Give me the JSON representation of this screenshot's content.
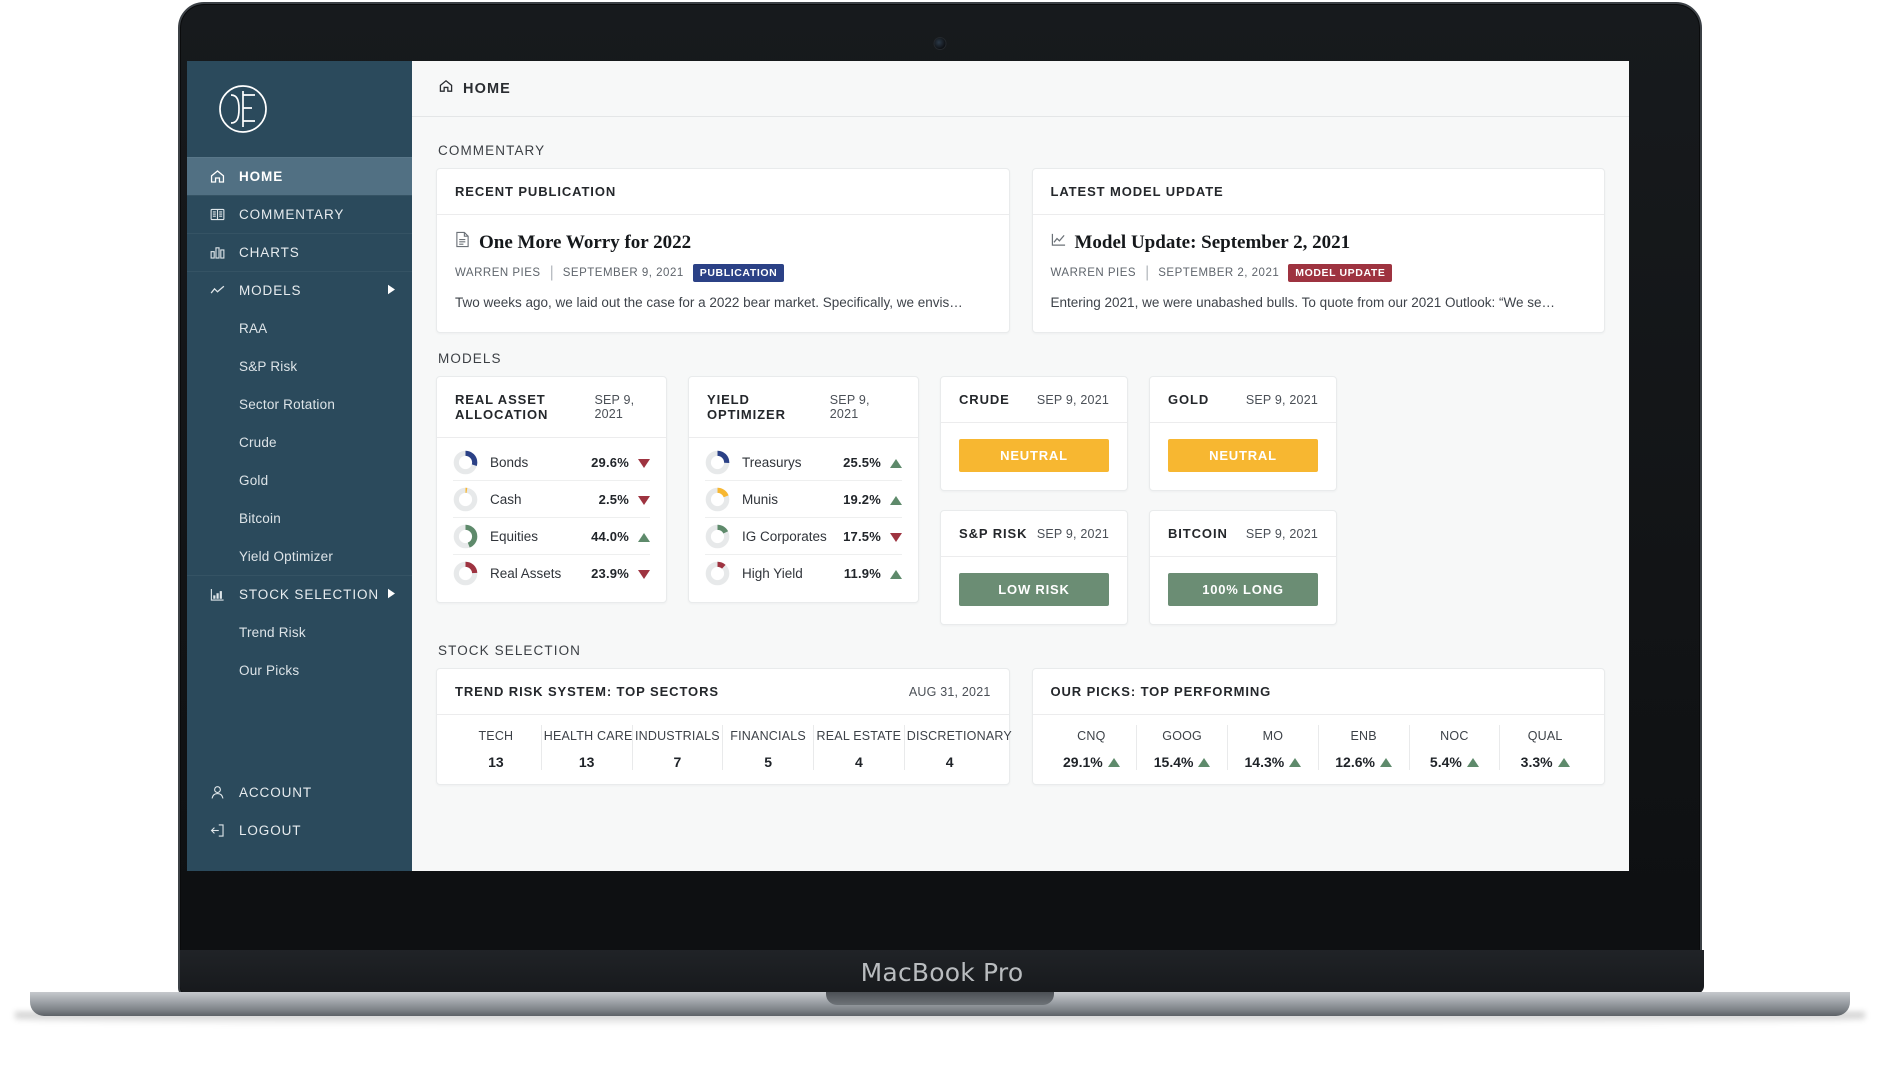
{
  "device": {
    "label": "MacBook Pro"
  },
  "brand": {
    "logo_alt": "AF monogram logo"
  },
  "sidebar": {
    "items": [
      {
        "label": "HOME",
        "icon": "home-icon",
        "active": true
      },
      {
        "label": "COMMENTARY",
        "icon": "book-icon",
        "active": false
      },
      {
        "label": "CHARTS",
        "icon": "bar-chart-icon",
        "active": false
      },
      {
        "label": "MODELS",
        "icon": "line-chart-icon",
        "active": false,
        "expandable": true
      }
    ],
    "models_sub": [
      "RAA",
      "S&P Risk",
      "Sector Rotation",
      "Crude",
      "Gold",
      "Bitcoin",
      "Yield Optimizer"
    ],
    "stock_selection": {
      "label": "STOCK SELECTION",
      "icon": "chart-bars-icon",
      "expandable": true
    },
    "stock_sub": [
      "Trend Risk",
      "Our Picks"
    ],
    "bottom": [
      {
        "label": "ACCOUNT",
        "icon": "user-icon"
      },
      {
        "label": "LOGOUT",
        "icon": "logout-icon"
      }
    ]
  },
  "topbar": {
    "title": "HOME",
    "icon": "home-icon"
  },
  "sections": {
    "commentary": "COMMENTARY",
    "models": "MODELS",
    "stock_selection": "STOCK SELECTION"
  },
  "commentary": {
    "cards": [
      {
        "header": "RECENT PUBLICATION",
        "icon": "document-icon",
        "title": "One More Worry for 2022",
        "author": "WARREN PIES",
        "separator": "|",
        "date": "SEPTEMBER 9, 2021",
        "tag": "PUBLICATION",
        "tag_color": "#2b4186",
        "excerpt": "Two weeks ago, we laid out the case for a 2022 bear market. Specifically, we envis…"
      },
      {
        "header": "LATEST MODEL UPDATE",
        "icon": "line-chart-icon",
        "title": "Model Update: September 2, 2021",
        "author": "WARREN PIES",
        "separator": "|",
        "date": "SEPTEMBER 2, 2021",
        "tag": "MODEL UPDATE",
        "tag_color": "#9e3340",
        "excerpt": "Entering 2021, we were unabashed bulls. To quote from our 2021 Outlook: “We se…"
      }
    ]
  },
  "models": {
    "allocation_cards": [
      {
        "title": "REAL ASSET ALLOCATION",
        "date": "SEP 9, 2021",
        "rows": [
          {
            "name": "Bonds",
            "value": "29.6%",
            "pct": 29.6,
            "color": "#2b4186",
            "direction": "down"
          },
          {
            "name": "Cash",
            "value": "2.5%",
            "pct": 2.5,
            "color": "#f7b731",
            "direction": "down"
          },
          {
            "name": "Equities",
            "value": "44.0%",
            "pct": 44.0,
            "color": "#5e8a6b",
            "direction": "up"
          },
          {
            "name": "Real Assets",
            "value": "23.9%",
            "pct": 23.9,
            "color": "#9e3340",
            "direction": "down"
          }
        ]
      },
      {
        "title": "YIELD OPTIMIZER",
        "date": "SEP 9, 2021",
        "rows": [
          {
            "name": "Treasurys",
            "value": "25.5%",
            "pct": 25.5,
            "color": "#2b4186",
            "direction": "up"
          },
          {
            "name": "Munis",
            "value": "19.2%",
            "pct": 19.2,
            "color": "#f7b731",
            "direction": "up"
          },
          {
            "name": "IG Corporates",
            "value": "17.5%",
            "pct": 17.5,
            "color": "#5e8a6b",
            "direction": "down"
          },
          {
            "name": "High Yield",
            "value": "11.9%",
            "pct": 11.9,
            "color": "#9e3340",
            "direction": "up"
          }
        ]
      }
    ],
    "status_cards": [
      {
        "title": "CRUDE",
        "date": "SEP 9, 2021",
        "status": "NEUTRAL",
        "status_color": "#f7b731"
      },
      {
        "title": "S&P RISK",
        "date": "SEP 9, 2021",
        "status": "LOW RISK",
        "status_color": "#6b8d74"
      },
      {
        "title": "GOLD",
        "date": "SEP 9, 2021",
        "status": "NEUTRAL",
        "status_color": "#f7b731"
      },
      {
        "title": "BITCOIN",
        "date": "SEP 9, 2021",
        "status": "100% LONG",
        "status_color": "#6b8d74"
      }
    ]
  },
  "stock_selection": {
    "trend_risk": {
      "title": "TREND RISK SYSTEM: TOP SECTORS",
      "date": "AUG 31, 2021",
      "columns": [
        "TECH",
        "HEALTH CARE",
        "INDUSTRIALS",
        "FINANCIALS",
        "REAL ESTATE",
        "DISCRETIONARY"
      ],
      "values": [
        "13",
        "13",
        "7",
        "5",
        "4",
        "4"
      ]
    },
    "our_picks": {
      "title": "OUR PICKS: TOP PERFORMING",
      "date": "",
      "columns": [
        "CNQ",
        "GOOG",
        "MO",
        "ENB",
        "NOC",
        "QUAL"
      ],
      "values": [
        "29.1%",
        "15.4%",
        "14.3%",
        "12.6%",
        "5.4%",
        "3.3%"
      ],
      "directions": [
        "up",
        "up",
        "up",
        "up",
        "up",
        "up"
      ]
    }
  },
  "chart_data": {
    "type": "pie",
    "title": "Real Asset Allocation & Yield Optimizer donut gauges",
    "charts": [
      {
        "name": "REAL ASSET ALLOCATION",
        "categories": [
          "Bonds",
          "Cash",
          "Equities",
          "Real Assets"
        ],
        "values": [
          29.6,
          2.5,
          44.0,
          23.9
        ],
        "colors": [
          "#2b4186",
          "#f7b731",
          "#5e8a6b",
          "#9e3340"
        ],
        "unit": "%"
      },
      {
        "name": "YIELD OPTIMIZER",
        "categories": [
          "Treasurys",
          "Munis",
          "IG Corporates",
          "High Yield"
        ],
        "values": [
          25.5,
          19.2,
          17.5,
          11.9
        ],
        "colors": [
          "#2b4186",
          "#f7b731",
          "#5e8a6b",
          "#9e3340"
        ],
        "unit": "%"
      },
      {
        "name": "TREND RISK SYSTEM: TOP SECTORS",
        "type": "bar",
        "categories": [
          "TECH",
          "HEALTH CARE",
          "INDUSTRIALS",
          "FINANCIALS",
          "REAL ESTATE",
          "DISCRETIONARY"
        ],
        "values": [
          13,
          13,
          7,
          5,
          4,
          4
        ]
      },
      {
        "name": "OUR PICKS: TOP PERFORMING",
        "type": "bar",
        "categories": [
          "CNQ",
          "GOOG",
          "MO",
          "ENB",
          "NOC",
          "QUAL"
        ],
        "values": [
          29.1,
          15.4,
          14.3,
          12.6,
          5.4,
          3.3
        ],
        "unit": "%"
      }
    ]
  }
}
